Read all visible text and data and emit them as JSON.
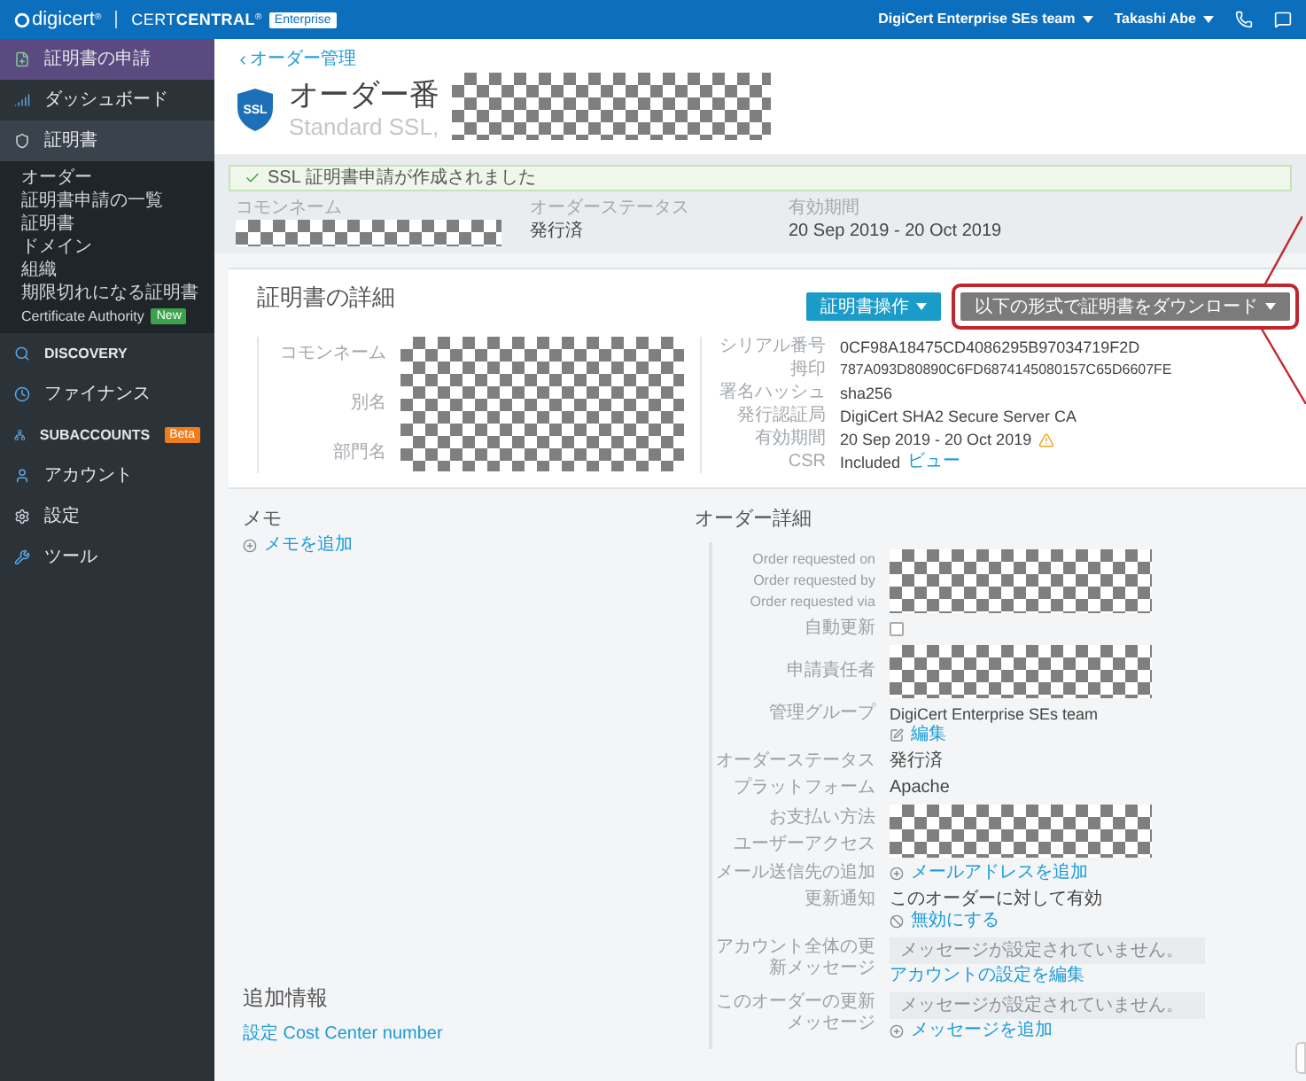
{
  "topbar": {
    "brand": "digicert",
    "brand_mark": "®",
    "product_light": "CERT",
    "product_bold": "CENTRAL",
    "product_mark": "®",
    "edition": "Enterprise",
    "team": "DigiCert Enterprise SEs team",
    "user": "Takashi Abe"
  },
  "sidebar": {
    "items": [
      {
        "label": "証明書の申請",
        "kind": "primary",
        "selected": false
      },
      {
        "label": "ダッシュボード",
        "kind": "nav",
        "selected": false
      },
      {
        "label": "証明書",
        "kind": "nav",
        "selected": true,
        "expanded": true,
        "children": [
          {
            "label": "オーダー",
            "selected": false
          },
          {
            "label": "証明書申請の一覧",
            "selected": false
          },
          {
            "label": "証明書",
            "selected": false
          },
          {
            "label": "ドメイン",
            "selected": false
          },
          {
            "label": "組織",
            "selected": false
          },
          {
            "label": "期限切れになる証明書",
            "selected": false
          },
          {
            "label": "Certificate Authority",
            "selected": false,
            "badge": {
              "text": "New",
              "color": "#3aa34a"
            }
          }
        ]
      },
      {
        "label": "DISCOVERY",
        "kind": "nav",
        "selected": false
      },
      {
        "label": "ファイナンス",
        "kind": "nav",
        "selected": false
      },
      {
        "label": "SUBACCOUNTS",
        "kind": "nav",
        "selected": false,
        "badge": {
          "text": "Beta",
          "color": "#f07c1c"
        }
      },
      {
        "label": "アカウント",
        "kind": "nav",
        "selected": false
      },
      {
        "label": "設定",
        "kind": "nav",
        "selected": false
      },
      {
        "label": "ツール",
        "kind": "nav",
        "selected": false
      }
    ]
  },
  "header": {
    "breadcrumb": "オーダー管理",
    "badge": "SSL",
    "title": "オーダー番",
    "subtitle": "Standard SSL,"
  },
  "alert": "SSL 証明書申請が作成されました",
  "summary": [
    {
      "label": "コモンネーム",
      "redacted": true
    },
    {
      "label": "オーダーステータス",
      "value": "発行済",
      "redacted": false
    },
    {
      "label": "有効期間",
      "value": "20 Sep 2019 - 20 Oct 2019",
      "redacted": false
    }
  ],
  "certificate": {
    "title": "証明書の詳細",
    "actions": [
      {
        "label": "証明書操作",
        "kind": "primary",
        "highlighted": false
      },
      {
        "label": "以下の形式で証明書をダウンロード",
        "kind": "secondary",
        "highlighted": true
      }
    ],
    "identity_labels": [
      "コモンネーム",
      "別名",
      "部門名"
    ],
    "fields": [
      {
        "label": "シリアル番号",
        "value": "0CF98A18475CD4086295B97034719F2D",
        "kind": "text",
        "warning": false
      },
      {
        "label": "拇印",
        "value": "787A093D80890C6FD6874145080157C65D6607FE",
        "kind": "small",
        "warning": false
      },
      {
        "label": "署名ハッシュ",
        "value": "sha256",
        "kind": "text",
        "warning": false
      },
      {
        "label": "発行認証局",
        "value": "DigiCert SHA2 Secure Server CA",
        "kind": "text",
        "warning": false
      },
      {
        "label": "有効期間",
        "value": "20 Sep 2019 - 20 Oct 2019",
        "kind": "text",
        "warning": true
      },
      {
        "label": "CSR",
        "value": "Included",
        "link": "ビュー",
        "kind": "text",
        "warning": false
      }
    ]
  },
  "memo": {
    "title": "メモ",
    "link": "メモを追加"
  },
  "additional": {
    "title": "追加情報",
    "link": "設定 Cost Center number"
  },
  "order": {
    "title": "オーダー詳細",
    "rows": [
      {
        "kind": "redacted",
        "labels": [
          "Order requested on",
          "Order requested by",
          "Order requested via"
        ]
      },
      {
        "kind": "checkbox",
        "labels": [
          "自動更新"
        ],
        "checked": false
      },
      {
        "kind": "redacted",
        "labels": [
          "申請責任者"
        ]
      },
      {
        "kind": "group",
        "labels": [
          "管理グループ"
        ],
        "value": "DigiCert Enterprise SEs team",
        "link": "編集"
      },
      {
        "kind": "text",
        "labels": [
          "オーダーステータス"
        ],
        "value": "発行済"
      },
      {
        "kind": "text",
        "labels": [
          "プラットフォーム"
        ],
        "value": "Apache"
      },
      {
        "kind": "redacted",
        "labels": [
          "お支払い方法",
          "ユーザーアクセス"
        ]
      },
      {
        "kind": "add",
        "labels": [
          "メール送信先の追加"
        ],
        "link": "メールアドレスを追加"
      },
      {
        "kind": "notice",
        "labels": [
          "更新通知"
        ],
        "value": "このオーダーに対して有効",
        "link": "無効にする"
      },
      {
        "kind": "message_edit",
        "labels": [
          "アカウント全体の更新メッセージ"
        ],
        "placeholder": "メッセージが設定されていません。",
        "link": "アカウントの設定を編集"
      },
      {
        "kind": "message_add",
        "labels": [
          "このオーダーの更新メッセージ"
        ],
        "placeholder": "メッセージが設定されていません。",
        "link": "メッセージを追加"
      }
    ]
  }
}
